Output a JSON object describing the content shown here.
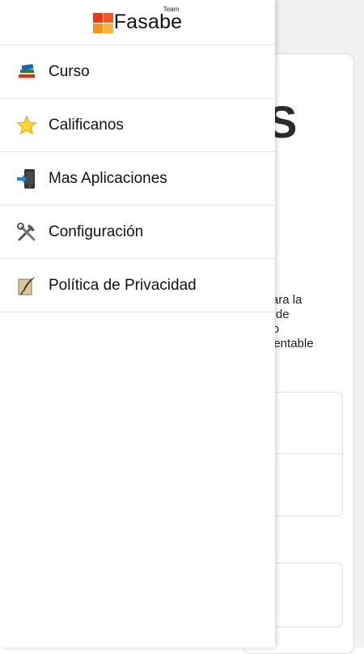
{
  "header": {
    "logo_text": "Fasabe",
    "logo_subtext": "Team"
  },
  "menu": {
    "items": [
      {
        "label": "Curso",
        "icon": "books-icon"
      },
      {
        "label": "Calificanos",
        "icon": "star-icon"
      },
      {
        "label": "Mas Aplicaciones",
        "icon": "mobile-arrow-icon"
      },
      {
        "label": "Configuración",
        "icon": "tools-icon"
      },
      {
        "label": "Política de Privacidad",
        "icon": "quill-icon"
      }
    ]
  },
  "background": {
    "big_glyph": "S",
    "description_lines": [
      "sos para la",
      "amos de",
      "a paso",
      "resa rentable"
    ]
  },
  "colors": {
    "logo_red": "#e8391d",
    "logo_orange": "#f15a24",
    "logo_amber": "#f7931e",
    "logo_yellow": "#fbb03b",
    "divider": "#e3e3e3"
  }
}
